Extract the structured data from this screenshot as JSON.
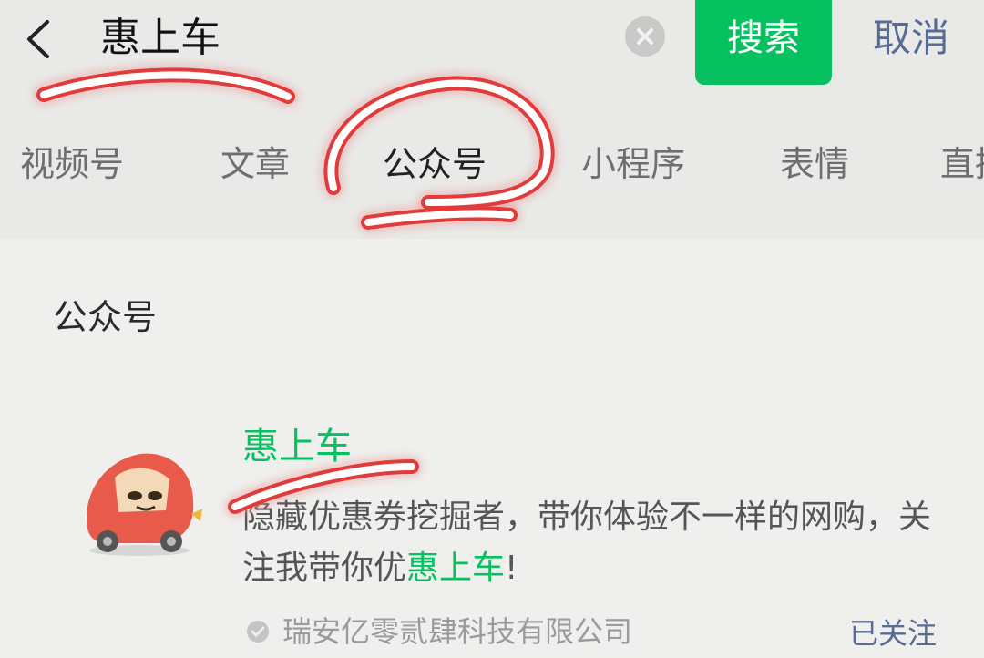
{
  "search": {
    "query": "惠上车",
    "search_label": "搜索",
    "cancel_label": "取消"
  },
  "tabs": [
    {
      "label": "视频号"
    },
    {
      "label": "文章"
    },
    {
      "label": "公众号",
      "active": true
    },
    {
      "label": "小程序"
    },
    {
      "label": "表情"
    },
    {
      "label": "直播"
    }
  ],
  "results": {
    "section_title": "公众号",
    "account": {
      "name": "惠上车",
      "description_before": "隐藏优惠券挖掘者，带你体验不一样的网购，关注我带你优",
      "description_highlight": "惠上车",
      "description_after": "!",
      "company": "瑞安亿零贰肆科技有限公司",
      "follow_status": "已关注"
    }
  },
  "colors": {
    "accent_green": "#07c160",
    "link_blue": "#576b95",
    "annotation_red": "#e23b3b"
  },
  "icons": [
    "back-icon",
    "clear-icon",
    "avatar-image",
    "company-icon"
  ]
}
